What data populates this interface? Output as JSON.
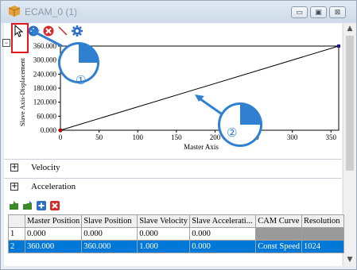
{
  "window": {
    "title": "ECAM_0 (1)",
    "minimize_glyph": "▭",
    "restore_glyph": "▣",
    "close_glyph": "⊠"
  },
  "toolbar": {
    "icons": [
      "arrow-cursor-icon",
      "add-point-icon",
      "delete-point-icon",
      "line-tool-icon",
      "settings-gear-icon"
    ]
  },
  "chart_data": {
    "type": "line",
    "xlabel": "Master Axis",
    "ylabel": "Slave Axis-Displacement",
    "xlim": [
      0,
      360
    ],
    "ylim": [
      0,
      360
    ],
    "x_ticks": [
      "0",
      "50",
      "100",
      "150",
      "200",
      "250",
      "300",
      "350"
    ],
    "y_ticks": [
      "0.000",
      "60.000",
      "120.000",
      "180.000",
      "240.000",
      "300.000",
      "360.000"
    ],
    "series": [
      {
        "x": [
          0,
          360
        ],
        "y": [
          0,
          360
        ]
      }
    ],
    "grid": true
  },
  "sections": {
    "velocity": "Velocity",
    "acceleration": "Acceleration"
  },
  "table": {
    "headers": [
      "",
      "Master Position",
      "Slave Position",
      "Slave Velocity",
      "Slave Accelerati...",
      "CAM Curve",
      "Resolution"
    ],
    "rows": [
      [
        "1",
        "0.000",
        "0.000",
        "0.000",
        "0.000",
        "",
        ""
      ],
      [
        "2",
        "360.000",
        "360.000",
        "1.000",
        "0.000",
        "Const Speed",
        "1024"
      ]
    ]
  },
  "annotations": {
    "badge_1": "①",
    "badge_2": "②"
  },
  "colors": {
    "accent_selection": "#0078d7",
    "callout_blue": "#2f80d0",
    "highlight_red": "#e01a1a"
  }
}
